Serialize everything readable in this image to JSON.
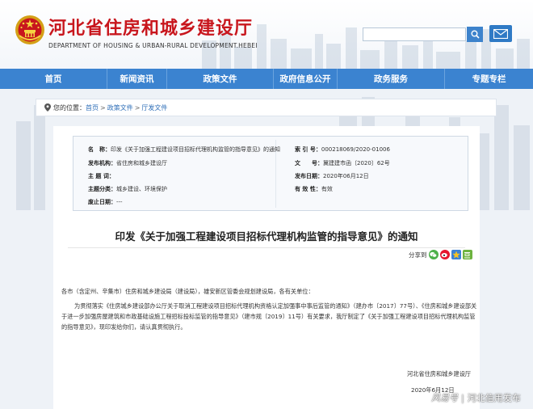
{
  "header": {
    "title": "河北省住房和城乡建设厅",
    "subtitle": "DEPARTMENT OF HOUSING & URBAN-RURAL DEVELOPMENT.HEBEI",
    "search_placeholder": "",
    "brand_color": "#c8161d"
  },
  "nav": {
    "items": [
      {
        "label": "首页"
      },
      {
        "label": "新闻资讯"
      },
      {
        "label": "政策文件"
      },
      {
        "label": "政府信息公开"
      },
      {
        "label": "政务服务"
      },
      {
        "label": "专题专栏"
      }
    ],
    "bg_color": "#3b83d0"
  },
  "breadcrumb": {
    "prefix": "您的位置：",
    "items": [
      "首页",
      "政策文件",
      "厅发文件"
    ],
    "separator": ">"
  },
  "meta": {
    "name_label": "名　称：",
    "name_value": "印发《关于加强工程建设项目招标代理机构监管的指导意见》的通知",
    "index_label": "索 引 号：",
    "index_value": "000218069/2020-01006",
    "issuer_label": "发布机构：",
    "issuer_value": "省住房和城乡建设厅",
    "docno_label": "文　　号：",
    "docno_value": "冀建建市函〔2020〕62号",
    "keywords_label": "主 题 词：",
    "keywords_value": "",
    "date_label": "发布日期：",
    "date_value": "2020年06月12日",
    "category_label": "主题分类：",
    "category_value": "城乡建设、环境保护",
    "validity_label": "有 效 性：",
    "validity_value": "有效",
    "expiry_label": "废止日期：",
    "expiry_value": "---"
  },
  "document": {
    "title": "印发《关于加强工程建设项目招标代理机构监管的指导意见》的通知",
    "share_label": "分享到",
    "salutation": "各市（含定州、辛集市）住房和城乡建设局（建设局），雄安新区管委会规划建设局，各有关单位：",
    "paragraph": "为贯彻落实《住房城乡建设部办公厅关于取消工程建设项目招标代理机构资格认定加强事中事后监管的通知》（建办市〔2017〕77号）、《住房和城乡建设部关于进一步加强房屋建筑和市政基础设施工程招标投标监管的指导意见》（建市规〔2019〕11号）有关要求，我厅制定了《关于加强工程建设项目招标代理机构监管的指导意见》，现印发给你们，请认真贯彻执行。",
    "signature_org": "河北省住房和城乡建设厅",
    "signature_date": "2020年6月12日"
  },
  "watermark": {
    "brand": "风易号",
    "separator": "|",
    "name": "河北信用发布"
  }
}
